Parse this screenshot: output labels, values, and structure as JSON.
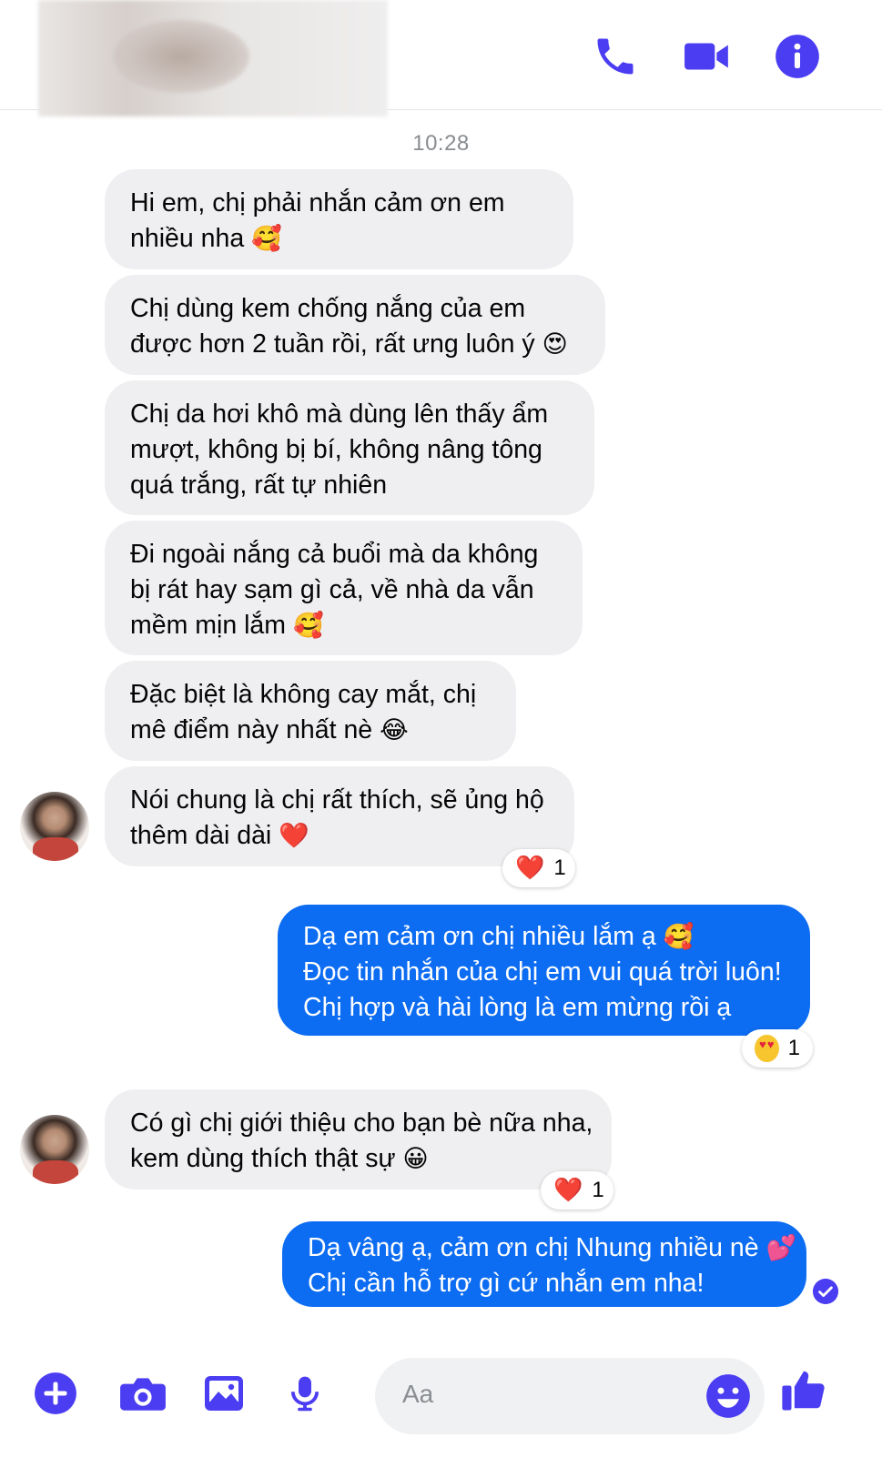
{
  "header": {
    "contact_name": ""
  },
  "timestamp": "10:28",
  "messages": [
    {
      "lines": [
        "Hi em, chị phải nhắn cảm ơn em",
        "nhiều nha"
      ],
      "emoji": "🥰"
    },
    {
      "lines": [
        "Chị dùng kem chống nắng của em",
        "được hơn 2 tuần rồi, rất ưng luôn ý"
      ],
      "emoji": "😍"
    },
    {
      "lines": [
        "Chị da hơi khô mà dùng lên thấy ẩm",
        "mượt, không bị bí, không nâng tông",
        "quá trắng, rất tự nhiên"
      ]
    },
    {
      "lines": [
        "Đi ngoài nắng cả buổi mà da không",
        "bị rát hay sạm gì cả, về nhà da vẫn",
        "mềm mịn lắm"
      ],
      "emoji": "🥰"
    },
    {
      "lines": [
        "Đặc biệt là không cay mắt, chị",
        "mê điểm này nhất nè"
      ],
      "emoji": "😂"
    },
    {
      "lines": [
        "Nói chung là chị rất thích, sẽ ủng hộ",
        "thêm dài dài"
      ],
      "emoji": "❤️",
      "reaction": {
        "emoji": "❤️",
        "count": "1"
      }
    },
    {
      "lines": [
        "Dạ em cảm ơn chị nhiều lắm ạ",
        "Đọc tin nhắn của chị em vui quá trời luôn!",
        "Chị hợp và hài lòng là em mừng rồi ạ"
      ],
      "emoji": "🥰",
      "reaction": {
        "emoji": "😍",
        "count": "1"
      }
    },
    {
      "lines": [
        "Có gì chị giới thiệu cho bạn bè nữa nha,",
        "kem dùng thích thật sự"
      ],
      "emoji": "😀",
      "reaction": {
        "emoji": "❤️",
        "count": "1"
      }
    },
    {
      "lines": [
        "Dạ vâng ạ, cảm ơn chị Nhung nhiều nè",
        "Chị cần hỗ trợ gì cứ nhắn em nha!"
      ],
      "emoji": "💕"
    }
  ],
  "composer": {
    "placeholder": "Aa"
  },
  "icons": {
    "call": "phone-icon",
    "video": "video-camera-icon",
    "info": "info-icon",
    "plus": "plus-icon",
    "camera": "camera-icon",
    "gallery": "image-icon",
    "mic": "microphone-icon",
    "emoji": "smiley-icon",
    "like": "thumbs-up-icon",
    "seen": "check-circle-icon"
  },
  "colors": {
    "accent": "#4b3df2",
    "outgoing_bubble": "#0c6cf2",
    "incoming_bubble": "#efeff1",
    "timestamp": "#8a8d91"
  }
}
